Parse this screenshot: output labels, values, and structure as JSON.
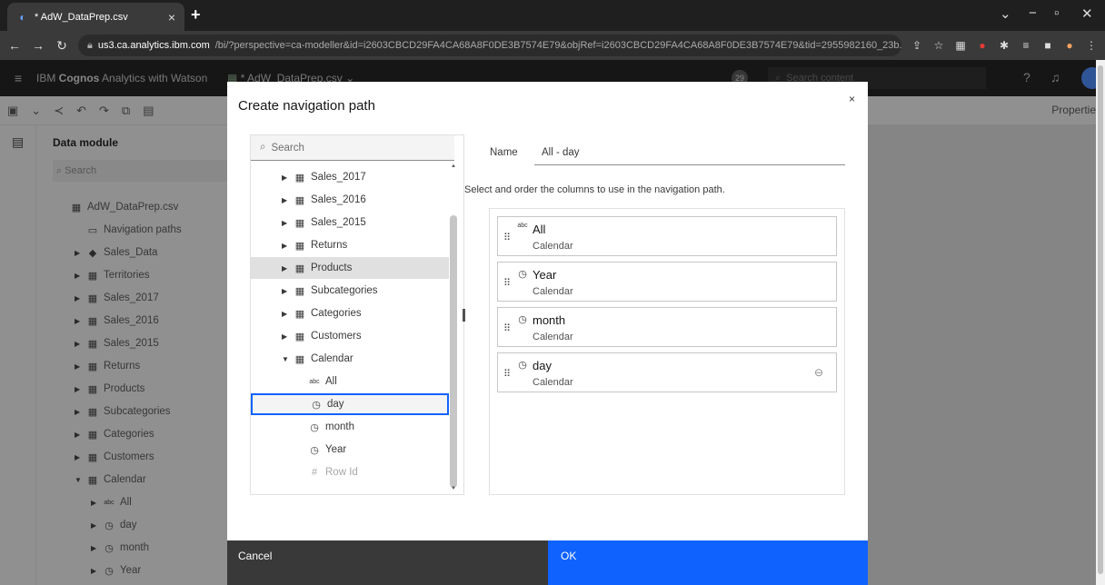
{
  "browser": {
    "tab_title": "* AdW_DataPrep.csv",
    "url_host": "us3.ca.analytics.ibm.com",
    "url_rest": "/bi/?perspective=ca-modeller&id=i2603CBCD29FA4CA68A8F0DE3B7574E79&objRef=i2603CBCD29FA4CA68A8F0DE3B7574E79&tid=2955982160_23b..."
  },
  "app": {
    "brand_prefix": "IBM ",
    "brand_bold": "Cognos",
    "brand_rest": " Analytics with Watson",
    "file_title": "* AdW_DataPrep.csv",
    "search_placeholder": "Search content",
    "notification_count": "29",
    "properties_label": "Properties"
  },
  "panel": {
    "header": "Data module",
    "search_placeholder": "Search",
    "tree": [
      {
        "label": "AdW_DataPrep.csv",
        "icon": "file-icon",
        "caret": "",
        "indent": 0
      },
      {
        "label": "Navigation paths",
        "icon": "folder-icon",
        "caret": "",
        "indent": 1
      },
      {
        "label": "Sales_Data",
        "icon": "cube-icon",
        "caret": "▶",
        "indent": 1
      },
      {
        "label": "Territories",
        "icon": "table-icon",
        "caret": "▶",
        "indent": 1
      },
      {
        "label": "Sales_2017",
        "icon": "table-icon",
        "caret": "▶",
        "indent": 1
      },
      {
        "label": "Sales_2016",
        "icon": "table-icon",
        "caret": "▶",
        "indent": 1
      },
      {
        "label": "Sales_2015",
        "icon": "table-icon",
        "caret": "▶",
        "indent": 1
      },
      {
        "label": "Returns",
        "icon": "table-icon",
        "caret": "▶",
        "indent": 1
      },
      {
        "label": "Products",
        "icon": "table-icon",
        "caret": "▶",
        "indent": 1
      },
      {
        "label": "Subcategories",
        "icon": "table-icon",
        "caret": "▶",
        "indent": 1
      },
      {
        "label": "Categories",
        "icon": "table-icon",
        "caret": "▶",
        "indent": 1
      },
      {
        "label": "Customers",
        "icon": "table-icon",
        "caret": "▶",
        "indent": 1
      },
      {
        "label": "Calendar",
        "icon": "table-icon",
        "caret": "▼",
        "indent": 1
      },
      {
        "label": "All",
        "icon": "abc-icon",
        "caret": "▶",
        "indent": 2
      },
      {
        "label": "day",
        "icon": "clock-icon",
        "caret": "▶",
        "indent": 2
      },
      {
        "label": "month",
        "icon": "clock-icon",
        "caret": "▶",
        "indent": 2
      },
      {
        "label": "Year",
        "icon": "clock-icon",
        "caret": "▶",
        "indent": 2
      }
    ]
  },
  "dialog": {
    "title": "Create navigation path",
    "search_placeholder": "Search",
    "list": [
      {
        "label": "Sales_2017",
        "icon": "table-icon",
        "caret": "▶",
        "state": ""
      },
      {
        "label": "Sales_2016",
        "icon": "table-icon",
        "caret": "▶",
        "state": ""
      },
      {
        "label": "Sales_2015",
        "icon": "table-icon",
        "caret": "▶",
        "state": ""
      },
      {
        "label": "Returns",
        "icon": "table-icon",
        "caret": "▶",
        "state": ""
      },
      {
        "label": "Products",
        "icon": "table-icon",
        "caret": "▶",
        "state": "hover"
      },
      {
        "label": "Subcategories",
        "icon": "table-icon",
        "caret": "▶",
        "state": ""
      },
      {
        "label": "Categories",
        "icon": "table-icon",
        "caret": "▶",
        "state": ""
      },
      {
        "label": "Customers",
        "icon": "table-icon",
        "caret": "▶",
        "state": ""
      },
      {
        "label": "Calendar",
        "icon": "table-icon",
        "caret": "▼",
        "state": ""
      },
      {
        "label": "All",
        "icon": "abc-icon",
        "caret": "",
        "state": ""
      },
      {
        "label": "day",
        "icon": "clock-icon",
        "caret": "",
        "state": "selected"
      },
      {
        "label": "month",
        "icon": "clock-icon",
        "caret": "",
        "state": ""
      },
      {
        "label": "Year",
        "icon": "clock-icon",
        "caret": "",
        "state": ""
      },
      {
        "label": "Row Id",
        "icon": "hash-icon",
        "caret": "",
        "state": "disabled"
      }
    ],
    "name_label": "Name",
    "name_value": "All - day",
    "instructions": "Select and order the columns to use in the navigation path.",
    "path_columns": [
      {
        "name": "All",
        "table": "Calendar",
        "icon": "abc-icon"
      },
      {
        "name": "Year",
        "table": "Calendar",
        "icon": "clock-icon"
      },
      {
        "name": "month",
        "table": "Calendar",
        "icon": "clock-icon"
      },
      {
        "name": "day",
        "table": "Calendar",
        "icon": "clock-icon"
      }
    ],
    "cancel_label": "Cancel",
    "ok_label": "OK"
  },
  "colors": {
    "primary": "#0f62fe",
    "cancel": "#393939",
    "header": "#161616"
  }
}
